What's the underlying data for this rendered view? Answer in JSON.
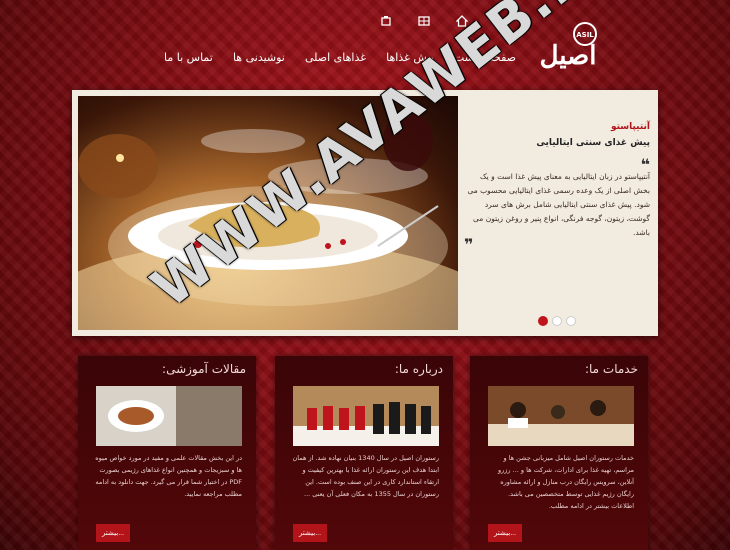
{
  "top_icons": [
    "sitemap-icon",
    "grid-icon",
    "home-icon"
  ],
  "logo": {
    "text": "اصیل",
    "badge": "ASIL"
  },
  "nav": {
    "items": [
      "صفحه نخست",
      "پیش غذاها",
      "غذاهای اصلی",
      "نوشیدنی ها",
      "تماس با ما"
    ]
  },
  "slider": {
    "title": "آنتیپاستو",
    "subtitle": "پیش غذای سنتی ایتالیایی",
    "body": "آنتیپاستو در زبان ایتالیایی به معنای پیش غذا است و یک بخش اصلی از یک وعده رسمی غذای ایتالیایی محسوب می شود. پیش غذای سنتی ایتالیایی شامل برش های سرد گوشت، زیتون، گوجه فرنگی، انواع پنیر و روغن زیتون می باشد.",
    "slides": 3,
    "active_slide": 1
  },
  "columns": [
    {
      "title": "خدمات ما:",
      "text": "خدمات رستوران اصیل شامل میزبانی جشن ها و مراسم، تهیه غذا برای ادارات، شرکت ها و ... رزرو آنلاین، سرویس رایگان درب منازل و ارائه مشاوره رایگان رژیم غذایی توسط متخصصین می باشد. اطلاعات بیشتر در ادامه مطلب.",
      "more": "بیشتر..."
    },
    {
      "title": "درباره ما:",
      "text": "رستوران اصیل در سال 1340 بنیان نهاده شد. از همان ابتدا هدف این رستوران ارائه غذا با بهترین کیفیت و ارتقاء استاندارد کاری در این صنف بوده است. این رستوران در سال 1355 به مکان فعلی آن یعنی ...",
      "more": "بیشتر..."
    },
    {
      "title": "مقالات آموزشی:",
      "text": "در این بخش مقالات علمی و مفید در مورد خواص میوه ها و سبزیجات و همچنین انواع غذاهای رژیمی بصورت PDF در اختیار شما قرار می گیرد. جهت دانلود به ادامه مطلب مراجعه نمایید.",
      "more": "بیشتر..."
    }
  ],
  "watermark": "WWW.AVAWEB.NET",
  "colors": {
    "accent": "#b3141a",
    "background": "#8a0f15",
    "panel": "#f2ebe0"
  }
}
